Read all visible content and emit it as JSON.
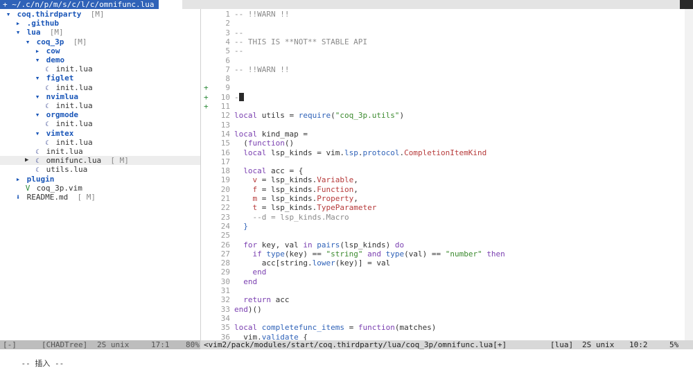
{
  "tab": {
    "icon": "+",
    "path": "~/.c/n/p/m/s/c/l/c/omnifunc.lua"
  },
  "tree": {
    "rows": [
      {
        "icon": "chevron-down-icon",
        "glyph": "▾",
        "label": "coq.thirdparty",
        "flag": "[M]",
        "kind": "dir",
        "depth": 0
      },
      {
        "icon": "folder-icon",
        "glyph": "▸",
        "label": ".github",
        "flag": "",
        "kind": "dir",
        "depth": 1
      },
      {
        "icon": "folder-icon",
        "glyph": "▾",
        "label": "lua",
        "flag": "[M]",
        "kind": "dir",
        "depth": 1
      },
      {
        "icon": "folder-icon",
        "glyph": "▾",
        "label": "coq_3p",
        "flag": "[M]",
        "kind": "dir",
        "depth": 2
      },
      {
        "icon": "folder-icon",
        "glyph": "▸",
        "label": "cow",
        "flag": "",
        "kind": "dir",
        "depth": 3
      },
      {
        "icon": "folder-icon",
        "glyph": "▾",
        "label": "demo",
        "flag": "",
        "kind": "dir",
        "depth": 3
      },
      {
        "icon": "lua-file-icon",
        "glyph": "☾",
        "label": "init.lua",
        "flag": "",
        "kind": "lua",
        "depth": 4
      },
      {
        "icon": "folder-icon",
        "glyph": "▾",
        "label": "figlet",
        "flag": "",
        "kind": "dir",
        "depth": 3
      },
      {
        "icon": "lua-file-icon",
        "glyph": "☾",
        "label": "init.lua",
        "flag": "",
        "kind": "lua",
        "depth": 4
      },
      {
        "icon": "folder-icon",
        "glyph": "▾",
        "label": "nvimlua",
        "flag": "",
        "kind": "dir",
        "depth": 3
      },
      {
        "icon": "lua-file-icon",
        "glyph": "☾",
        "label": "init.lua",
        "flag": "",
        "kind": "lua",
        "depth": 4
      },
      {
        "icon": "folder-icon",
        "glyph": "▾",
        "label": "orgmode",
        "flag": "",
        "kind": "dir",
        "depth": 3
      },
      {
        "icon": "lua-file-icon",
        "glyph": "☾",
        "label": "init.lua",
        "flag": "",
        "kind": "lua",
        "depth": 4
      },
      {
        "icon": "folder-icon",
        "glyph": "▾",
        "label": "vimtex",
        "flag": "",
        "kind": "dir",
        "depth": 3
      },
      {
        "icon": "lua-file-icon",
        "glyph": "☾",
        "label": "init.lua",
        "flag": "",
        "kind": "lua",
        "depth": 4
      },
      {
        "icon": "lua-file-icon",
        "glyph": "☾",
        "label": "init.lua",
        "flag": "",
        "kind": "lua",
        "depth": 3
      },
      {
        "icon": "lua-file-icon",
        "glyph": "☾",
        "label": "omnifunc.lua",
        "flag": "[ M]",
        "kind": "lua",
        "depth": 3,
        "selected": true,
        "marker": "▶"
      },
      {
        "icon": "lua-file-icon",
        "glyph": "☾",
        "label": "utils.lua",
        "flag": "",
        "kind": "lua",
        "depth": 3
      },
      {
        "icon": "folder-icon",
        "glyph": "▸",
        "label": "plugin",
        "flag": "",
        "kind": "dir",
        "depth": 1
      },
      {
        "icon": "vim-file-icon",
        "glyph": "V",
        "label": "coq_3p.vim",
        "flag": "",
        "kind": "vim",
        "depth": 2
      },
      {
        "icon": "markdown-file-icon",
        "glyph": "⬇",
        "label": "README.md",
        "flag": "[ M]",
        "kind": "md",
        "depth": 1
      }
    ]
  },
  "editor": {
    "lines": [
      {
        "n": "1",
        "sign": "",
        "html": "<span class=\"tok-comment\">-- !!WARN !!</span>"
      },
      {
        "n": "2",
        "sign": "",
        "html": ""
      },
      {
        "n": "3",
        "sign": "",
        "html": "<span class=\"tok-comment\">--</span>"
      },
      {
        "n": "4",
        "sign": "",
        "html": "<span class=\"tok-comment\">-- THIS IS **NOT** STABLE API</span>"
      },
      {
        "n": "5",
        "sign": "",
        "html": "<span class=\"tok-comment\">--</span>"
      },
      {
        "n": "6",
        "sign": "",
        "html": ""
      },
      {
        "n": "7",
        "sign": "",
        "html": "<span class=\"tok-comment\">-- !!WARN !!</span>"
      },
      {
        "n": "8",
        "sign": "",
        "html": ""
      },
      {
        "n": "9",
        "sign": "+",
        "html": ""
      },
      {
        "n": "10",
        "sign": "+",
        "html": "<span class=\"tok-comment\">-</span><span class=\"cursor-block\" data-name=\"text-cursor\"></span>"
      },
      {
        "n": "11",
        "sign": "+",
        "html": ""
      },
      {
        "n": "12",
        "sign": "",
        "html": "<span class=\"tok-kw\">local</span> utils = <span class=\"tok-fn\">require</span>(<span class=\"tok-str\">\"coq_3p.utils\"</span>)"
      },
      {
        "n": "13",
        "sign": "",
        "html": ""
      },
      {
        "n": "14",
        "sign": "",
        "html": "<span class=\"tok-kw\">local</span> kind_map ="
      },
      {
        "n": "15",
        "sign": "",
        "html": "  (<span class=\"tok-kw\">function</span>()"
      },
      {
        "n": "16",
        "sign": "",
        "html": "  <span class=\"tok-kw\">local</span> lsp_kinds = vim.<span class=\"tok-fn\">lsp</span>.<span class=\"tok-fn\">protocol</span>.<span class=\"tok-field\">CompletionItemKind</span>"
      },
      {
        "n": "17",
        "sign": "",
        "html": ""
      },
      {
        "n": "18",
        "sign": "",
        "html": "  <span class=\"tok-kw\">local</span> acc = {"
      },
      {
        "n": "19",
        "sign": "",
        "html": "    <span class=\"tok-field\">v</span> = lsp_kinds.<span class=\"tok-field\">Variable</span>,"
      },
      {
        "n": "20",
        "sign": "",
        "html": "    <span class=\"tok-field\">f</span> = lsp_kinds.<span class=\"tok-field\">Function</span>,"
      },
      {
        "n": "21",
        "sign": "",
        "html": "    <span class=\"tok-field\">m</span> = lsp_kinds.<span class=\"tok-field\">Property</span>,"
      },
      {
        "n": "22",
        "sign": "",
        "html": "    <span class=\"tok-field\">t</span> = lsp_kinds.<span class=\"tok-field\">TypeParameter</span>"
      },
      {
        "n": "23",
        "sign": "",
        "html": "    <span class=\"tok-comment\">--d = lsp_kinds.Macro</span>"
      },
      {
        "n": "24",
        "sign": "",
        "html": "  <span class=\"tok-punct\">}</span>"
      },
      {
        "n": "25",
        "sign": "",
        "html": ""
      },
      {
        "n": "26",
        "sign": "",
        "html": "  <span class=\"tok-kw\">for</span> key, val <span class=\"tok-kw\">in</span> <span class=\"tok-fn\">pairs</span>(lsp_kinds) <span class=\"tok-kw\">do</span>"
      },
      {
        "n": "27",
        "sign": "",
        "html": "    <span class=\"tok-kw\">if</span> <span class=\"tok-fn\">type</span>(key) == <span class=\"tok-str\">\"string\"</span> <span class=\"tok-kw\">and</span> <span class=\"tok-fn\">type</span>(val) == <span class=\"tok-str\">\"number\"</span> <span class=\"tok-kw\">then</span>"
      },
      {
        "n": "28",
        "sign": "",
        "html": "      acc[string.<span class=\"tok-fn\">lower</span>(key)] = val"
      },
      {
        "n": "29",
        "sign": "",
        "html": "    <span class=\"tok-kw\">end</span>"
      },
      {
        "n": "30",
        "sign": "",
        "html": "  <span class=\"tok-kw\">end</span>"
      },
      {
        "n": "31",
        "sign": "",
        "html": ""
      },
      {
        "n": "32",
        "sign": "",
        "html": "  <span class=\"tok-kw\">return</span> acc"
      },
      {
        "n": "33",
        "sign": "",
        "html": "<span class=\"tok-kw\">end</span>)()"
      },
      {
        "n": "34",
        "sign": "",
        "html": ""
      },
      {
        "n": "35",
        "sign": "",
        "html": "<span class=\"tok-kw\">local</span> <span class=\"tok-fn\">completefunc_items</span> = <span class=\"tok-kw\">function</span>(matches)"
      },
      {
        "n": "36",
        "sign": "",
        "html": "  vim.<span class=\"tok-fn\">validate</span> {"
      }
    ]
  },
  "status": {
    "left_mode": "[-]",
    "left_name": "[CHADTree]",
    "left_enc": "2S unix",
    "left_pos": "17:1",
    "left_pct": "80%",
    "right_path": "<vim2/pack/modules/start/coq.thirdparty/lua/coq_3p/omnifunc.lua[+]",
    "right_ft": "[lua]",
    "right_enc": "2S unix",
    "right_pos": "10:2",
    "right_pct": "5%"
  },
  "cmdline": {
    "text": "-- 插入 --"
  }
}
